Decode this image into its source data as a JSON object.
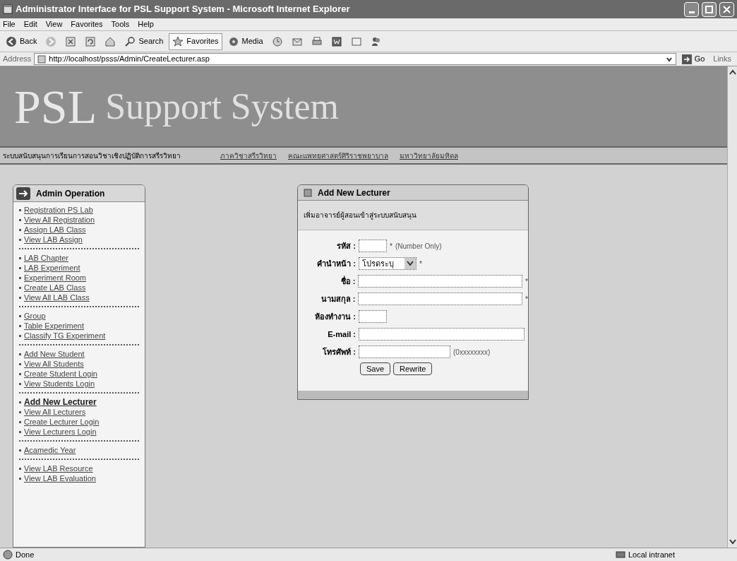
{
  "window": {
    "title": "Administrator Interface for PSL Support System - Microsoft Internet Explorer"
  },
  "menu": [
    "File",
    "Edit",
    "View",
    "Favorites",
    "Tools",
    "Help"
  ],
  "toolbar": [
    {
      "kind": "back",
      "label": "Back"
    },
    {
      "kind": "forward"
    },
    {
      "kind": "stop"
    },
    {
      "kind": "refresh"
    },
    {
      "kind": "home"
    },
    {
      "kind": "search",
      "label": "Search"
    },
    {
      "kind": "favorites",
      "label": "Favorites"
    },
    {
      "kind": "media",
      "label": "Media"
    },
    {
      "kind": "history"
    },
    {
      "kind": "mail"
    },
    {
      "kind": "print"
    },
    {
      "kind": "word"
    },
    {
      "kind": "discuss"
    },
    {
      "kind": "messenger"
    }
  ],
  "address": {
    "label": "Address",
    "url": "http://localhost/psss/Admin/CreateLecturer.asp",
    "go": "Go",
    "links": "Links"
  },
  "banner": {
    "logo": "PSL",
    "title": "Support System",
    "subtitle": "ระบบสนับสนุนการเรียนการสอนวิชาเชิงปฏิบัติการสรีรวิทยา",
    "links": [
      "ภาควิชาสรีรวิทยา",
      "คณะแพทยศาสตร์ศิริราชพยาบาล",
      "มหาวิทยาลัยมหิดล"
    ]
  },
  "sidebar": {
    "title": "Admin Operation",
    "groups": [
      [
        {
          "label": "Registration PS Lab",
          "selected": false
        },
        {
          "label": "View All Registration",
          "selected": false
        },
        {
          "label": "Assign LAB Class",
          "selected": false
        },
        {
          "label": "View LAB Assign",
          "selected": false
        }
      ],
      [
        {
          "label": "LAB Chapter",
          "selected": false
        },
        {
          "label": "LAB Experiment",
          "selected": false
        },
        {
          "label": "Experiment Room",
          "selected": false
        },
        {
          "label": "Create LAB Class",
          "selected": false
        },
        {
          "label": "View All LAB Class",
          "selected": false
        }
      ],
      [
        {
          "label": "Group",
          "selected": false
        },
        {
          "label": "Table Experiment",
          "selected": false
        },
        {
          "label": "Classify TG Experiment",
          "selected": false
        }
      ],
      [
        {
          "label": "Add New Student",
          "selected": false
        },
        {
          "label": "View All Students",
          "selected": false
        },
        {
          "label": "Create Student Login",
          "selected": false
        },
        {
          "label": "View Students Login",
          "selected": false
        }
      ],
      [
        {
          "label": "Add New Lecturer",
          "selected": true
        },
        {
          "label": "View All Lecturers",
          "selected": false
        },
        {
          "label": "Create Lecturer Login",
          "selected": false
        },
        {
          "label": "View Lecturers Login",
          "selected": false
        }
      ],
      [
        {
          "label": "Acamedic Year",
          "selected": false
        }
      ],
      [
        {
          "label": "View LAB Resource",
          "selected": false
        },
        {
          "label": "View LAB Evaluation",
          "selected": false
        }
      ]
    ]
  },
  "dialog": {
    "title": "Add New Lecturer",
    "description": "เพิ่มอาจารย์ผู้สอนเข้าสู่ระบบสนับสนุน",
    "fields": [
      {
        "kind": "short",
        "label": "รหัส :",
        "mark": "*",
        "hint": "(Number Only)"
      },
      {
        "kind": "select",
        "label": "คำนำหน้า :",
        "value": "โปรดระบุ",
        "mark": "*"
      },
      {
        "kind": "long",
        "label": "ชื่อ :",
        "mark": "*"
      },
      {
        "kind": "long",
        "label": "นามสกุล :",
        "mark": "*"
      },
      {
        "kind": "short",
        "label": "ห้องทำงาน :"
      },
      {
        "kind": "long",
        "label": "E-mail :"
      },
      {
        "kind": "medium",
        "label": "โทรศัพท์ :",
        "hint": "(0xxxxxxxx)"
      }
    ],
    "buttons": [
      "Save",
      "Rewrite"
    ]
  },
  "status_bar": {
    "text": "Done",
    "zone": "Local intranet"
  }
}
